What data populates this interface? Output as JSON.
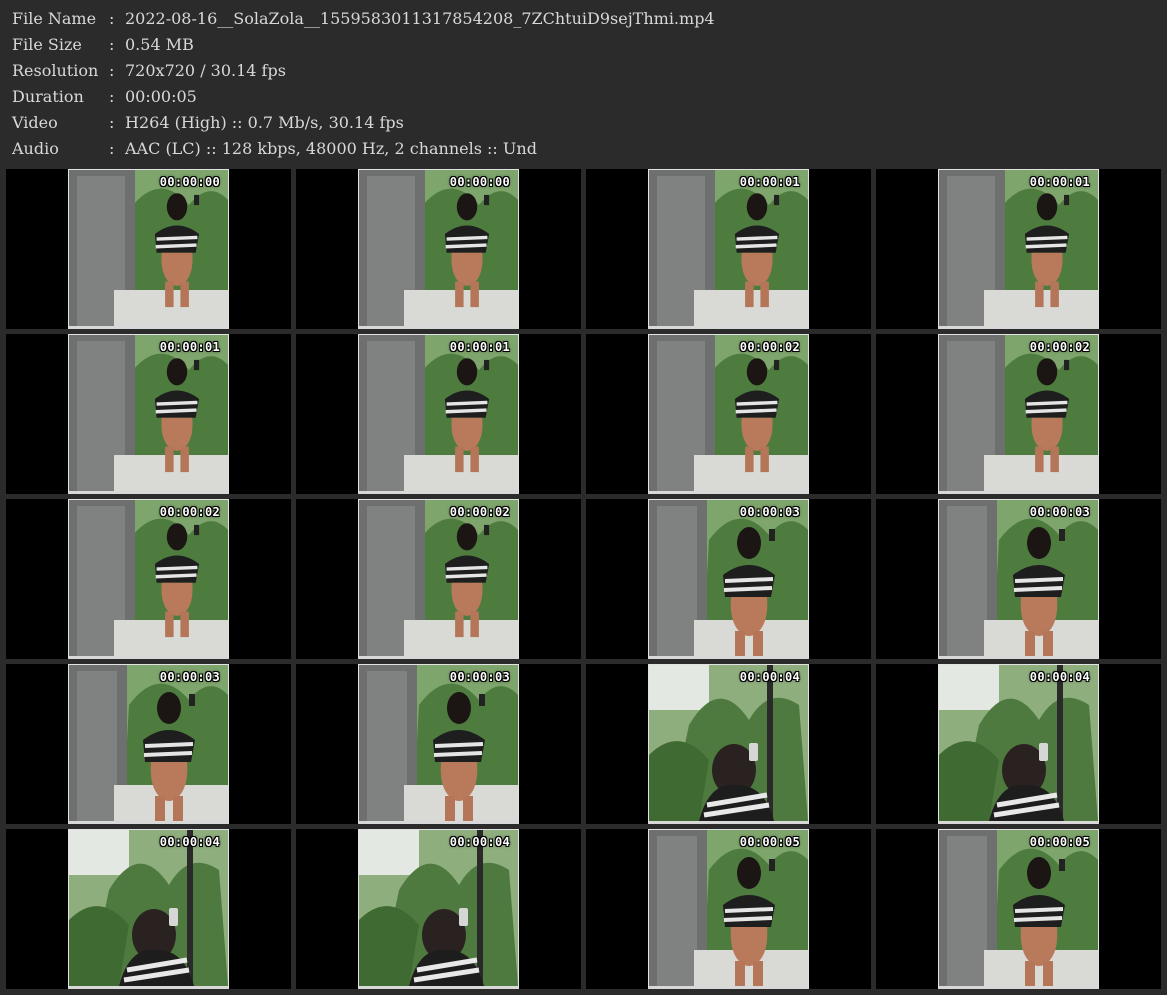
{
  "info": {
    "rows": [
      {
        "key": "File Name",
        "sep": ":",
        "value": "2022-08-16__SolaZola__1559583011317854208_7ZChtuiD9sejThmi.mp4"
      },
      {
        "key": "File Size",
        "sep": ":",
        "value": "0.54 MB"
      },
      {
        "key": "Resolution",
        "sep": ":",
        "value": "720x720 / 30.14 fps"
      },
      {
        "key": "Duration",
        "sep": ":",
        "value": "00:00:05"
      },
      {
        "key": "Video",
        "sep": ":",
        "value": "H264 (High) :: 0.7 Mb/s, 30.14 fps"
      },
      {
        "key": "Audio",
        "sep": ":",
        "value": "AAC (LC) :: 128 kbps, 48000 Hz, 2 channels :: Und"
      }
    ]
  },
  "thumbnails": [
    {
      "timestamp": "00:00:00",
      "scene": "mirror-wide"
    },
    {
      "timestamp": "00:00:00",
      "scene": "mirror-wide"
    },
    {
      "timestamp": "00:00:01",
      "scene": "mirror-wide"
    },
    {
      "timestamp": "00:00:01",
      "scene": "mirror-wide"
    },
    {
      "timestamp": "00:00:01",
      "scene": "mirror-wide"
    },
    {
      "timestamp": "00:00:01",
      "scene": "mirror-wide"
    },
    {
      "timestamp": "00:00:02",
      "scene": "mirror-wide"
    },
    {
      "timestamp": "00:00:02",
      "scene": "mirror-wide"
    },
    {
      "timestamp": "00:00:02",
      "scene": "mirror-wide"
    },
    {
      "timestamp": "00:00:02",
      "scene": "mirror-wide"
    },
    {
      "timestamp": "00:00:03",
      "scene": "mirror-mid"
    },
    {
      "timestamp": "00:00:03",
      "scene": "mirror-mid"
    },
    {
      "timestamp": "00:00:03",
      "scene": "mirror-mid"
    },
    {
      "timestamp": "00:00:03",
      "scene": "mirror-mid"
    },
    {
      "timestamp": "00:00:04",
      "scene": "close"
    },
    {
      "timestamp": "00:00:04",
      "scene": "close"
    },
    {
      "timestamp": "00:00:04",
      "scene": "close"
    },
    {
      "timestamp": "00:00:04",
      "scene": "close"
    },
    {
      "timestamp": "00:00:05",
      "scene": "mirror-mid"
    },
    {
      "timestamp": "00:00:05",
      "scene": "mirror-mid"
    }
  ],
  "colors": {
    "background": "#2b2b2b",
    "text": "#d8d8d8",
    "cell": "#000000",
    "timestamp": "#ffffff"
  }
}
